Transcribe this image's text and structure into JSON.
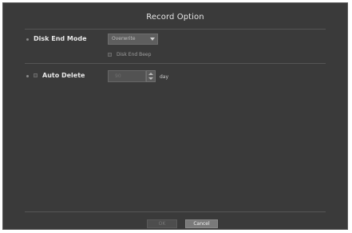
{
  "dialog": {
    "title": "Record Option"
  },
  "disk_end_mode": {
    "label": "Disk End Mode",
    "selected": "Overwrite",
    "beep_label": "Disk End Beep",
    "beep_checked": false
  },
  "auto_delete": {
    "label": "Auto Delete",
    "checked": false,
    "days_value": "90",
    "unit": "day"
  },
  "buttons": {
    "ok": "OK",
    "cancel": "Cancel"
  }
}
